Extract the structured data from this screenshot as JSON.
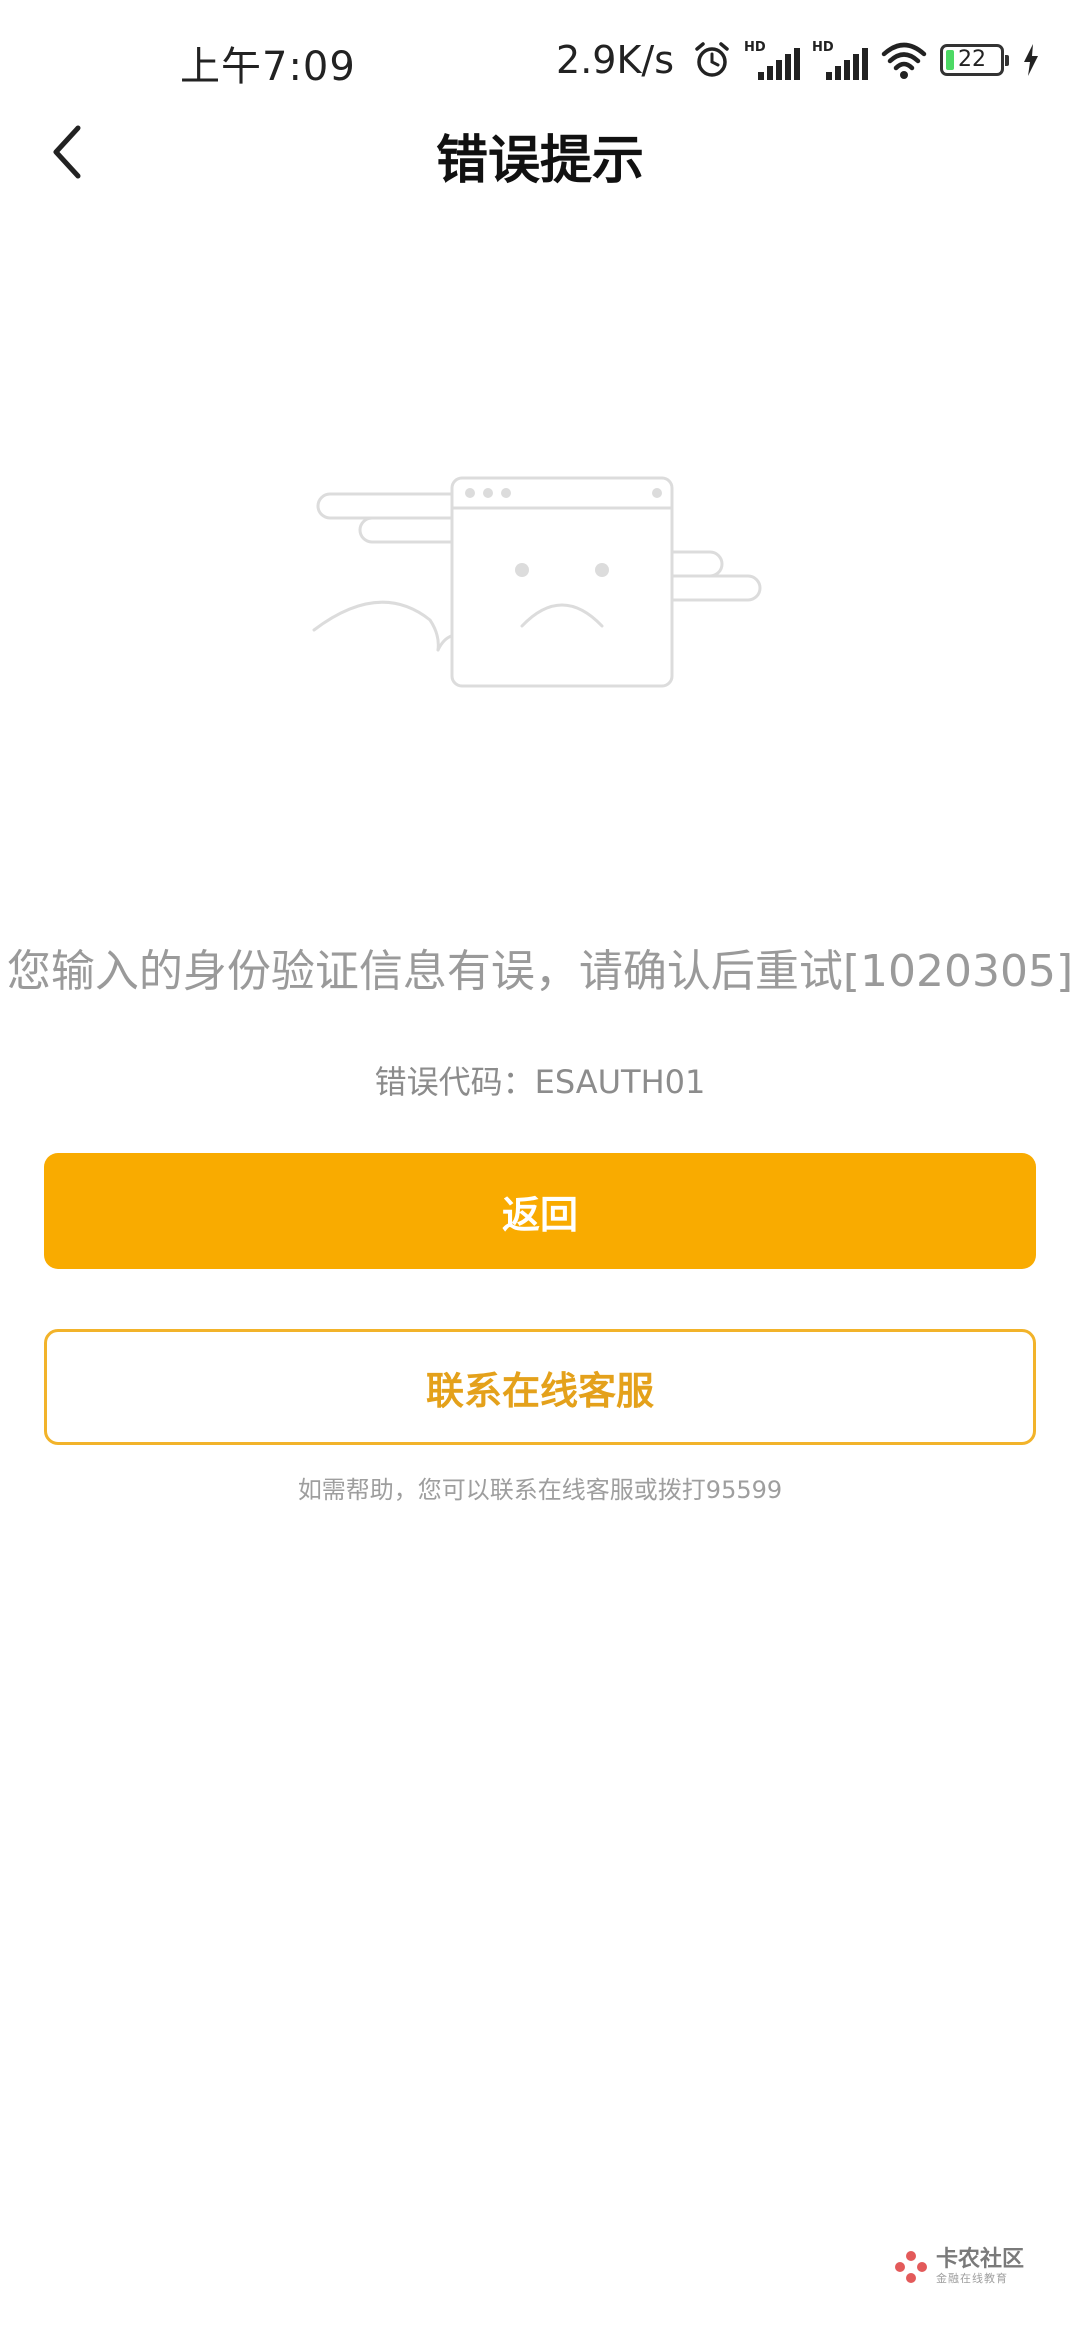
{
  "status_bar": {
    "time": "上午7:09",
    "net_speed": "2.9K/s",
    "battery_level": "22",
    "icons": [
      "alarm-icon",
      "hd-signal-icon",
      "hd-signal-icon",
      "wifi-icon",
      "battery-icon",
      "charging-icon"
    ]
  },
  "nav": {
    "title": "错误提示",
    "back_icon": "chevron-left-icon"
  },
  "illustration": {
    "icon": "sad-browser-window-icon"
  },
  "error": {
    "message": "您输入的身份验证信息有误，请确认后重试[1020305]",
    "code_label": "错误代码：ESAUTH01"
  },
  "actions": {
    "primary_label": "返回",
    "secondary_label": "联系在线客服"
  },
  "help": {
    "text": "如需帮助，您可以联系在线客服或拨打95599"
  },
  "watermark": {
    "title": "卡农社区",
    "subtitle": "金融在线教育"
  },
  "colors": {
    "accent": "#f9ab00",
    "accent_outline": "#f2b32a",
    "muted_text": "#9a9a9a"
  }
}
